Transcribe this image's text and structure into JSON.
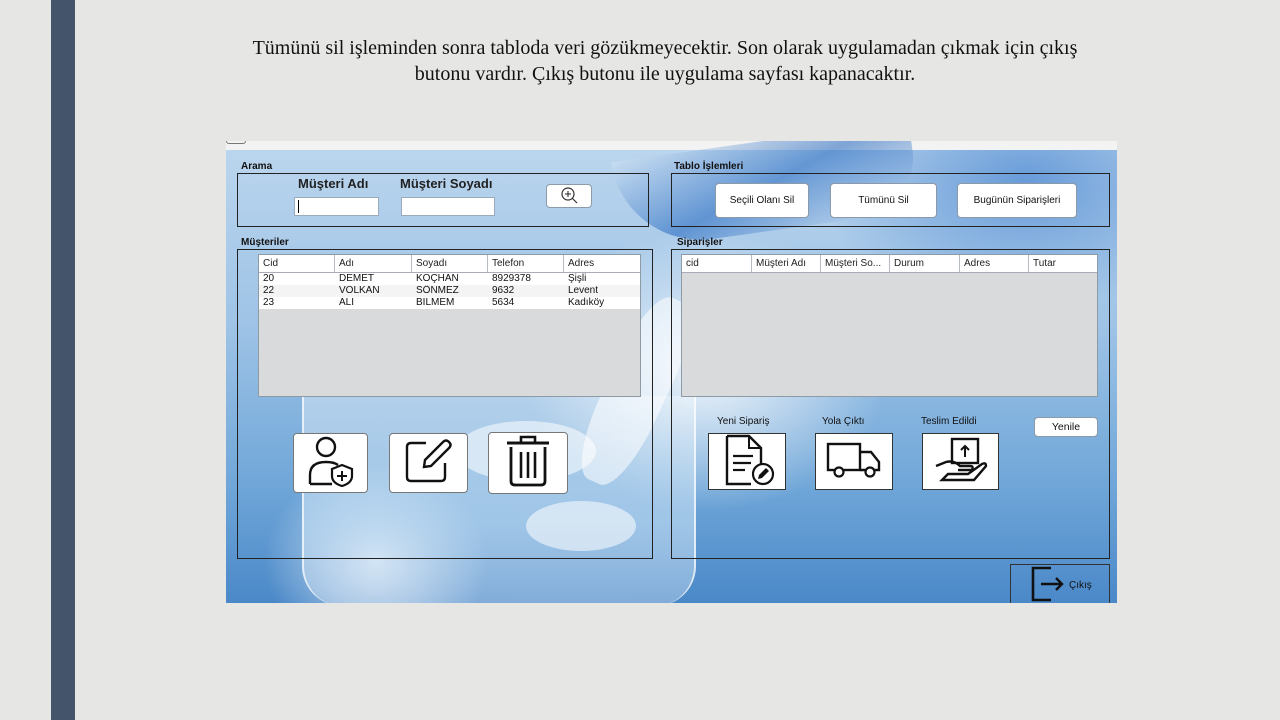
{
  "slide": {
    "caption_line1": "Tümünü sil işleminden sonra tabloda veri gözükmeyecektir. Son olarak uygulamadan çıkmak için çıkış",
    "caption_line2": "butonu vardır. Çıkış butonu ile uygulama sayfası kapanacaktır."
  },
  "search": {
    "section_label": "Arama",
    "first_name_label": "Müşteri Adı",
    "last_name_label": "Müşteri Soyadı",
    "first_name_value": "",
    "last_name_value": "",
    "search_icon": "zoom-in-icon"
  },
  "table_ops": {
    "section_label": "Tablo İşlemleri",
    "delete_selected_label": "Seçili Olanı Sil",
    "delete_all_label": "Tümünü Sil",
    "todays_orders_label": "Bugünün Siparişleri"
  },
  "customers": {
    "section_label": "Müşteriler",
    "columns": [
      "Cid",
      "Adı",
      "Soyadı",
      "Telefon",
      "Adres"
    ],
    "rows": [
      [
        "20",
        "DEMET",
        "KOÇHAN",
        "8929378",
        "Şişli"
      ],
      [
        "22",
        "VOLKAN",
        "SÖNMEZ",
        "9632",
        "Levent"
      ],
      [
        "23",
        "ALİ",
        "BİLMEM",
        "5634",
        "Kadıköy"
      ]
    ],
    "add_icon": "user-add-icon",
    "edit_icon": "edit-icon",
    "delete_icon": "trash-icon"
  },
  "orders": {
    "section_label": "Siparişler",
    "columns": [
      "cid",
      "Müşteri Adı",
      "Müşteri So...",
      "Durum",
      "Adres",
      "Tutar"
    ],
    "rows": [],
    "new_order_label": "Yeni Sipariş",
    "on_the_way_label": "Yola Çıktı",
    "delivered_label": "Teslim Edildi",
    "refresh_label": "Yenile",
    "new_order_icon": "document-edit-icon",
    "truck_icon": "truck-icon",
    "delivered_icon": "package-hand-icon"
  },
  "exit": {
    "label": "Çıkış",
    "icon": "exit-icon"
  },
  "colors": {
    "sidebar_bar": "#44546a",
    "slide_background": "#e6e6e4",
    "water_accent": "#4a88c8"
  }
}
